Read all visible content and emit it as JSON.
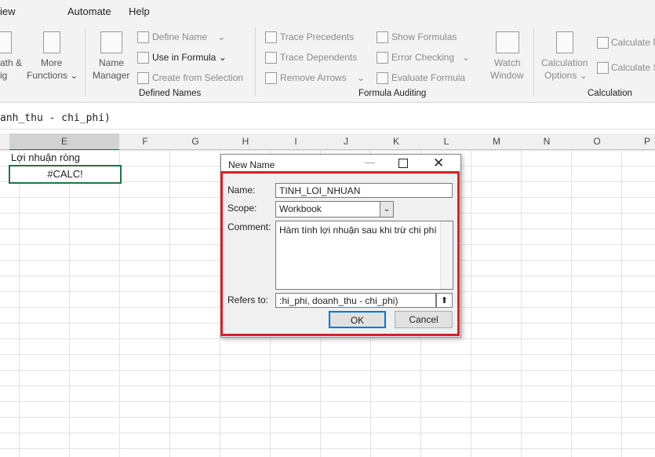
{
  "menu": {
    "items": [
      "iew",
      "Automate",
      "Help"
    ]
  },
  "ribbon": {
    "math_label_1": "ath &",
    "math_label_2": "ig",
    "more_functions_1": "More",
    "more_functions_2": "Functions",
    "name_manager_1": "Name",
    "name_manager_2": "Manager",
    "define_name": "Define Name",
    "use_in_formula": "Use in Formula",
    "create_from_selection": "Create from Selection",
    "defined_names_title": "Defined Names",
    "trace_precedents": "Trace Precedents",
    "trace_dependents": "Trace Dependents",
    "remove_arrows": "Remove Arrows",
    "show_formulas": "Show Formulas",
    "error_checking": "Error Checking",
    "evaluate_formula": "Evaluate Formula",
    "watch_window_1": "Watch",
    "watch_window_2": "Window",
    "formula_auditing_title": "Formula Auditing",
    "calc_options_1": "Calculation",
    "calc_options_2": "Options",
    "calculate_now": "Calculate N",
    "calculate_sheet": "Calculate S",
    "calculation_title": "Calculation"
  },
  "formula_bar": {
    "text": "anh_thu - chi_phi)"
  },
  "columns": [
    "E",
    "F",
    "G",
    "H",
    "I",
    "J",
    "K",
    "L",
    "M",
    "N",
    "O",
    "P"
  ],
  "cells": {
    "e1": "Lợi nhuận ròng",
    "e2": "#CALC!"
  },
  "dialog": {
    "title": "New Name",
    "name_label": "Name:",
    "name_value": "TINH_LOI_NHUAN",
    "scope_label": "Scope:",
    "scope_value": "Workbook",
    "comment_label": "Comment:",
    "comment_value": "Hàm tính lợi nhuận sau khi trừ chi phí",
    "refers_label": "Refers to:",
    "refers_value": ":hi_phi, doanh_thu - chi_phi)",
    "ok_label": "OK",
    "cancel_label": "Cancel"
  }
}
